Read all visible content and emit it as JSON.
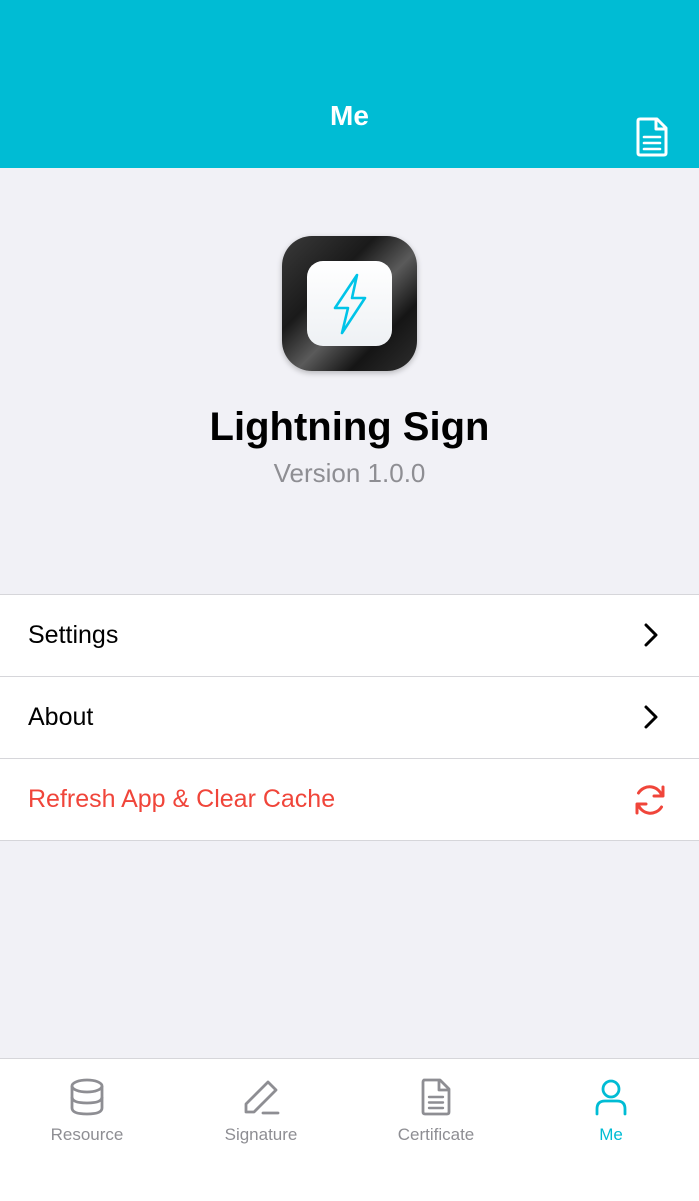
{
  "header": {
    "title": "Me",
    "doc_icon": "document-icon"
  },
  "app": {
    "name": "Lightning Sign",
    "version": "Version 1.0.0",
    "icon": "lightning-bolt-icon"
  },
  "menu": {
    "items": [
      {
        "label": "Settings",
        "icon": "chevron-right-icon"
      },
      {
        "label": "About",
        "icon": "chevron-right-icon"
      },
      {
        "label": "Refresh App & Clear Cache",
        "icon": "refresh-icon"
      }
    ]
  },
  "tabs": [
    {
      "label": "Resource",
      "icon": "database-icon"
    },
    {
      "label": "Signature",
      "icon": "pen-icon"
    },
    {
      "label": "Certificate",
      "icon": "document-icon"
    },
    {
      "label": "Me",
      "icon": "person-icon",
      "active": true
    }
  ],
  "colors": {
    "accent": "#00bcd4",
    "danger": "#f0453a",
    "secondary_text": "#8e8e93",
    "background": "#f1f1f6"
  }
}
